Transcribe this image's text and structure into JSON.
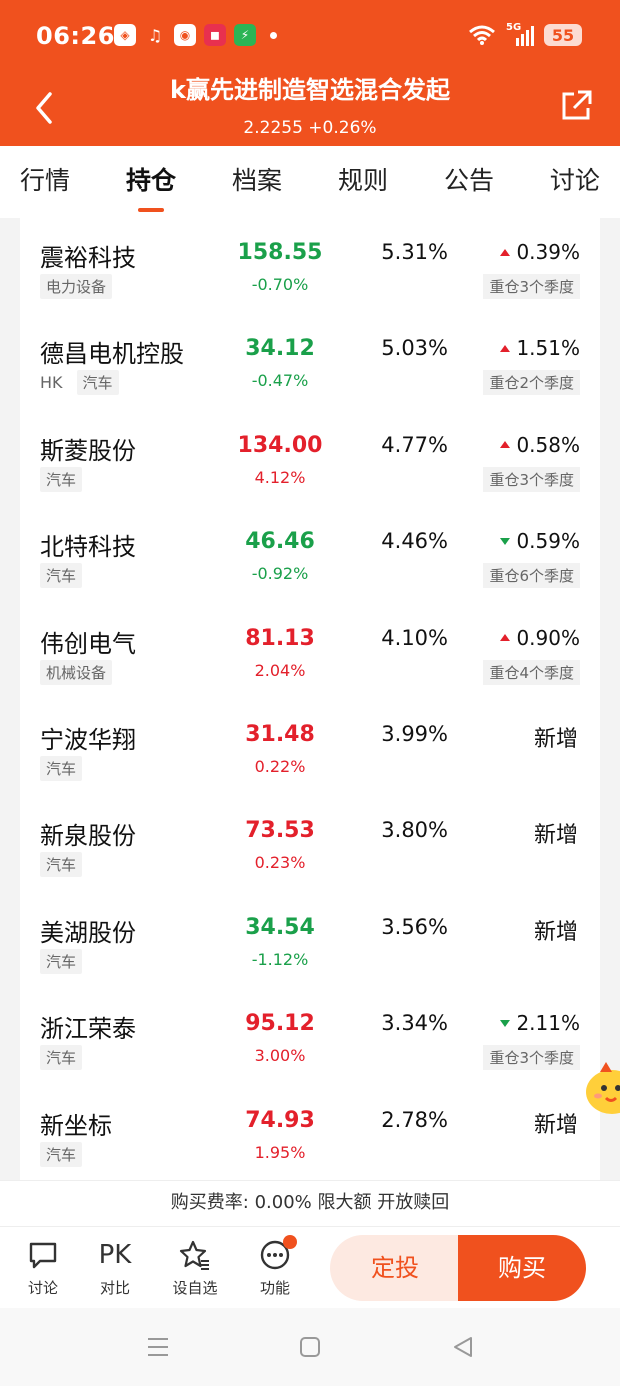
{
  "status_bar": {
    "time": "06:26",
    "notif_icons": [
      "app-icon",
      "listen-icon",
      "weibo-icon",
      "xiaohongshu-icon",
      "security-icon"
    ],
    "network": "5G",
    "battery": "55"
  },
  "header": {
    "title": "k赢先进制造智选混合发起",
    "nav": "2.2255 +0.26%",
    "accent": "#f0511e"
  },
  "tabs": [
    "行情",
    "持仓",
    "档案",
    "规则",
    "公告",
    "讨论"
  ],
  "active_tab": "持仓",
  "holdings": [
    {
      "name": "震裕科技",
      "tags": [
        "电力设备"
      ],
      "price": "158.55",
      "change": "-0.70%",
      "direction": "down",
      "weight": "5.31%",
      "weight_change": "0.39%",
      "weight_trend": "up",
      "badge": "重仓3个季度"
    },
    {
      "name": "德昌电机控股",
      "market": "HK",
      "tags": [
        "汽车"
      ],
      "price": "34.12",
      "change": "-0.47%",
      "direction": "down",
      "weight": "5.03%",
      "weight_change": "1.51%",
      "weight_trend": "up",
      "badge": "重仓2个季度"
    },
    {
      "name": "斯菱股份",
      "tags": [
        "汽车"
      ],
      "price": "134.00",
      "change": "4.12%",
      "direction": "up",
      "weight": "4.77%",
      "weight_change": "0.58%",
      "weight_trend": "up",
      "badge": "重仓3个季度"
    },
    {
      "name": "北特科技",
      "tags": [
        "汽车"
      ],
      "price": "46.46",
      "change": "-0.92%",
      "direction": "down",
      "weight": "4.46%",
      "weight_change": "0.59%",
      "weight_trend": "down",
      "badge": "重仓6个季度"
    },
    {
      "name": "伟创电气",
      "tags": [
        "机械设备"
      ],
      "price": "81.13",
      "change": "2.04%",
      "direction": "up",
      "weight": "4.10%",
      "weight_change": "0.90%",
      "weight_trend": "up",
      "badge": "重仓4个季度"
    },
    {
      "name": "宁波华翔",
      "tags": [
        "汽车"
      ],
      "price": "31.48",
      "change": "0.22%",
      "direction": "up",
      "weight": "3.99%",
      "status": "新增"
    },
    {
      "name": "新泉股份",
      "tags": [
        "汽车"
      ],
      "price": "73.53",
      "change": "0.23%",
      "direction": "up",
      "weight": "3.80%",
      "status": "新增"
    },
    {
      "name": "美湖股份",
      "tags": [
        "汽车"
      ],
      "price": "34.54",
      "change": "-1.12%",
      "direction": "down",
      "weight": "3.56%",
      "status": "新增"
    },
    {
      "name": "浙江荣泰",
      "tags": [
        "汽车"
      ],
      "price": "95.12",
      "change": "3.00%",
      "direction": "up",
      "weight": "3.34%",
      "weight_change": "2.11%",
      "weight_trend": "down",
      "badge": "重仓3个季度"
    },
    {
      "name": "新坐标",
      "tags": [
        "汽车"
      ],
      "price": "74.93",
      "change": "1.95%",
      "direction": "up",
      "weight": "2.78%",
      "status": "新增"
    }
  ],
  "fee_notice": "购买费率: 0.00% 限大额 开放赎回",
  "bottom_bar": {
    "discuss": "讨论",
    "pk_glyph": "PK",
    "compare": "对比",
    "watchlist": "设自选",
    "more": "功能",
    "auto_invest": "定投",
    "buy": "购买"
  },
  "colors": {
    "up": "#e3202b",
    "down": "#1aa04a",
    "accent": "#f0511e"
  }
}
